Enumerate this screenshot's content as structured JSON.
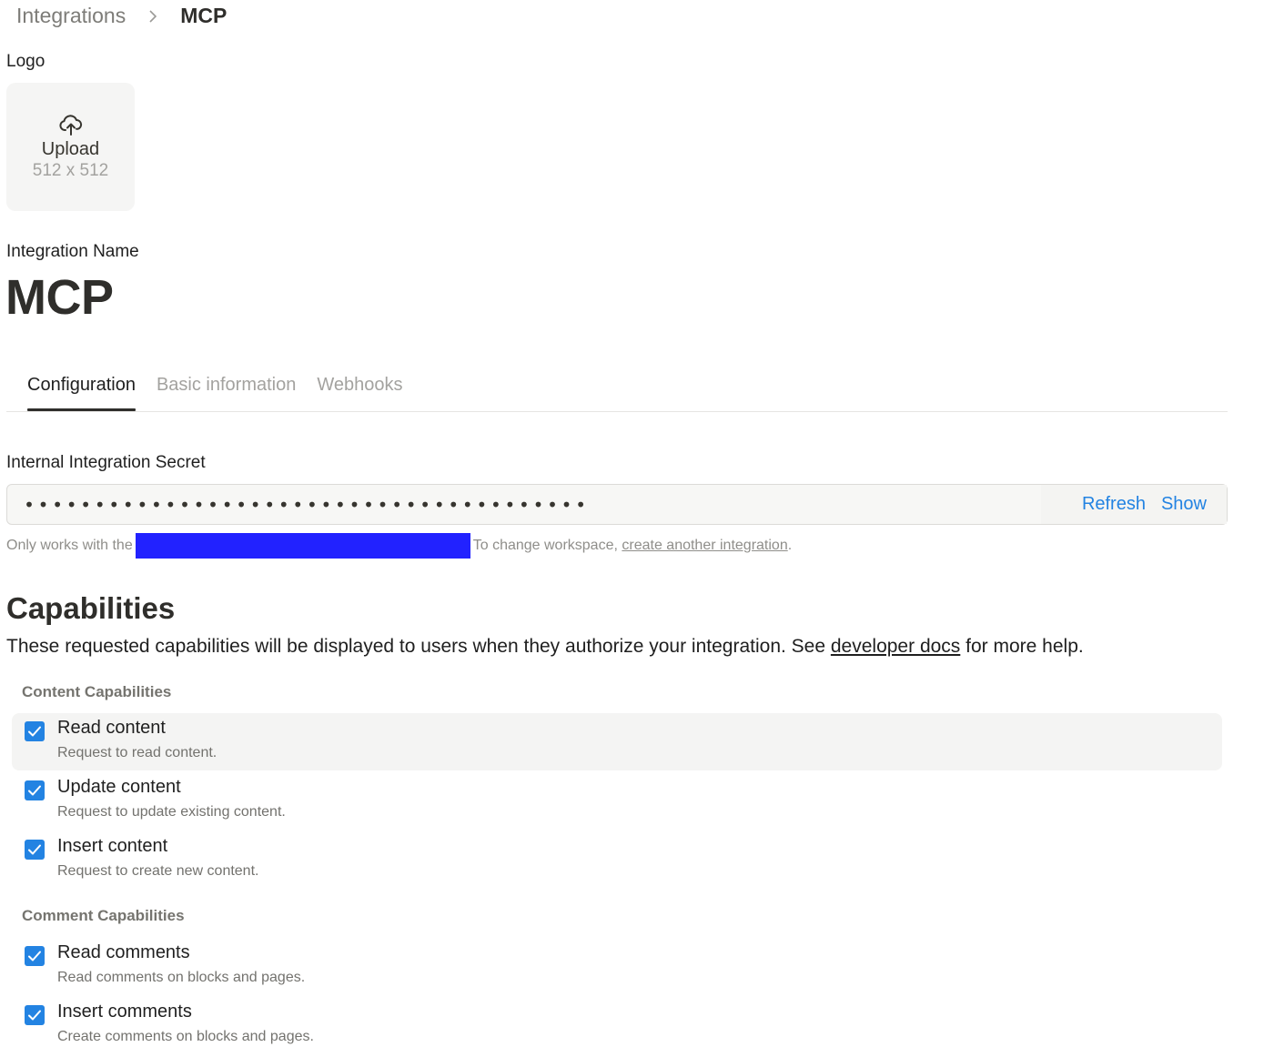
{
  "breadcrumb": {
    "parent": "Integrations",
    "current": "MCP"
  },
  "logo": {
    "label": "Logo",
    "upload_text": "Upload",
    "size_hint": "512 x 512",
    "icon": "cloud-upload-icon"
  },
  "integration_name": {
    "label": "Integration Name",
    "value": "MCP"
  },
  "tabs": [
    {
      "label": "Configuration",
      "active": true
    },
    {
      "label": "Basic information",
      "active": false
    },
    {
      "label": "Webhooks",
      "active": false
    }
  ],
  "secret": {
    "label": "Internal Integration Secret",
    "masked_value": "••••••••••••••••••••••••••••••••••••••••",
    "refresh_label": "Refresh",
    "show_label": "Show"
  },
  "workspace_note": {
    "prefix": "Only works with the",
    "suffix": "To change workspace,",
    "link": "create another integration",
    "end": "."
  },
  "capabilities": {
    "title": "Capabilities",
    "description_prefix": "These requested capabilities will be displayed to users when they authorize your integration. See",
    "description_link": "developer docs",
    "description_suffix": "for more help.",
    "content_group": {
      "title": "Content Capabilities",
      "items": [
        {
          "name": "Read content",
          "description": "Request to read content.",
          "checked": true
        },
        {
          "name": "Update content",
          "description": "Request to update existing content.",
          "checked": true
        },
        {
          "name": "Insert content",
          "description": "Request to create new content.",
          "checked": true
        }
      ]
    },
    "comment_group": {
      "title": "Comment Capabilities",
      "items": [
        {
          "name": "Read comments",
          "description": "Read comments on blocks and pages.",
          "checked": true
        },
        {
          "name": "Insert comments",
          "description": "Create comments on blocks and pages.",
          "checked": true
        }
      ]
    }
  },
  "colors": {
    "accent": "#2383e2",
    "redaction": "#2222ff"
  }
}
